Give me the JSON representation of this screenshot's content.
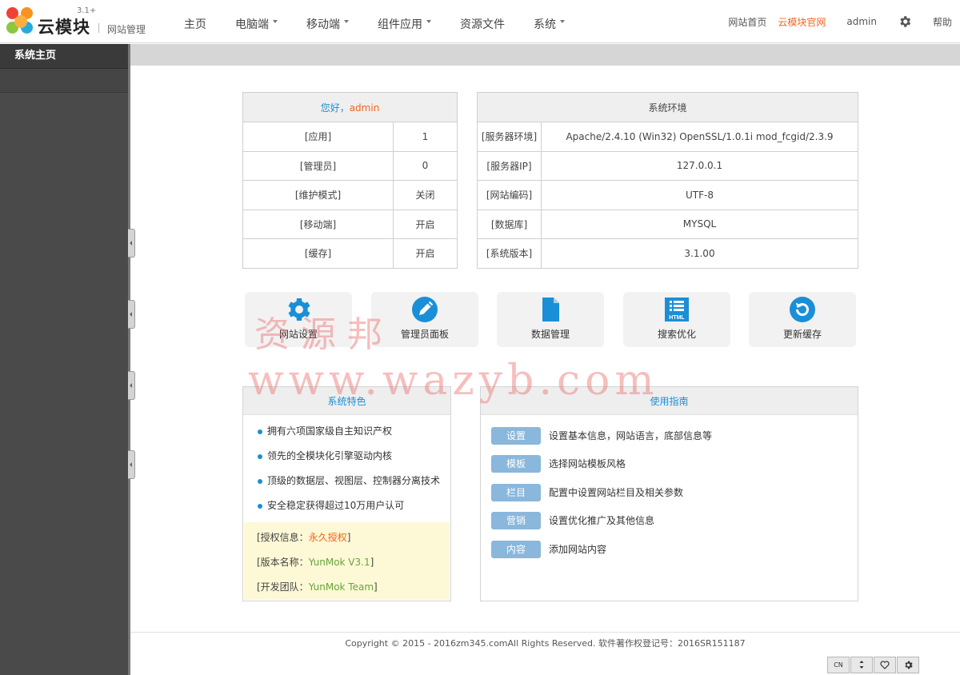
{
  "app": {
    "brand": "云模块",
    "version": "3.1+",
    "subtitle": "网站管理"
  },
  "nav": [
    {
      "label": "主页",
      "dropdown": false
    },
    {
      "label": "电脑端",
      "dropdown": true
    },
    {
      "label": "移动端",
      "dropdown": true
    },
    {
      "label": "组件应用",
      "dropdown": true
    },
    {
      "label": "资源文件",
      "dropdown": false
    },
    {
      "label": "系统",
      "dropdown": true
    }
  ],
  "top_links": {
    "site_home": "网站首页",
    "official": "云模块官网",
    "user": "admin",
    "help": "帮助"
  },
  "sidebar": {
    "title": "系统主页"
  },
  "welcome": {
    "greeting": "您好，",
    "user": "admin",
    "rows": [
      {
        "label": "[应用]",
        "value": "1"
      },
      {
        "label": "[管理员]",
        "value": "0"
      },
      {
        "label": "[维护模式]",
        "value": "关闭"
      },
      {
        "label": "[移动端]",
        "value": "开启"
      },
      {
        "label": "[缓存]",
        "value": "开启"
      }
    ]
  },
  "env": {
    "title": "系统环境",
    "rows": [
      {
        "label": "[服务器环境]",
        "value": "Apache/2.4.10 (Win32) OpenSSL/1.0.1i mod_fcgid/2.3.9"
      },
      {
        "label": "[服务器IP]",
        "value": "127.0.0.1"
      },
      {
        "label": "[网站编码]",
        "value": "UTF-8"
      },
      {
        "label": "[数据库]",
        "value": "MYSQL"
      },
      {
        "label": "[系统版本]",
        "value": "3.1.00"
      }
    ]
  },
  "quick": [
    {
      "label": "网站设置",
      "icon": "gear-icon"
    },
    {
      "label": "管理员面板",
      "icon": "pencil-icon"
    },
    {
      "label": "数据管理",
      "icon": "document-icon"
    },
    {
      "label": "搜索优化",
      "icon": "html-list-icon"
    },
    {
      "label": "更新缓存",
      "icon": "refresh-icon"
    }
  ],
  "features": {
    "title": "系统特色",
    "items": [
      "拥有六项国家级自主知识产权",
      "领先的全模块化引擎驱动内核",
      "顶级的数据层、视图层、控制器分离技术",
      "安全稳定获得超过10万用户认可"
    ],
    "license": [
      {
        "label": "[授权信息：",
        "value": "永久授权",
        "suffix": "]"
      },
      {
        "label": "[版本名称：",
        "value": "YunMok V3.1",
        "suffix": "]"
      },
      {
        "label": "[开发团队：",
        "value": "YunMok Team",
        "suffix": "]"
      }
    ]
  },
  "guide": {
    "title": "使用指南",
    "items": [
      {
        "btn": "设置",
        "desc": "设置基本信息，网站语言，底部信息等"
      },
      {
        "btn": "模板",
        "desc": "选择网站模板风格"
      },
      {
        "btn": "栏目",
        "desc": "配置中设置网站栏目及相关参数"
      },
      {
        "btn": "营销",
        "desc": "设置优化推广及其他信息"
      },
      {
        "btn": "内容",
        "desc": "添加网站内容"
      }
    ]
  },
  "footer": {
    "text": "Copyright © 2015 - 2016zm345.comAll Rights Reserved. 软件著作权登记号：2016SR151187"
  },
  "mini_bar": {
    "lang": "CN"
  },
  "watermark": {
    "line1": "资源邦",
    "line2": "www.wazyb.com"
  },
  "colors": {
    "accent_blue": "#1a8fd8",
    "accent_orange": "#f26522",
    "sidebar_bg": "#4a4a4a",
    "guide_button": "#8ab7dc",
    "license_bg": "#fdf9d6"
  }
}
